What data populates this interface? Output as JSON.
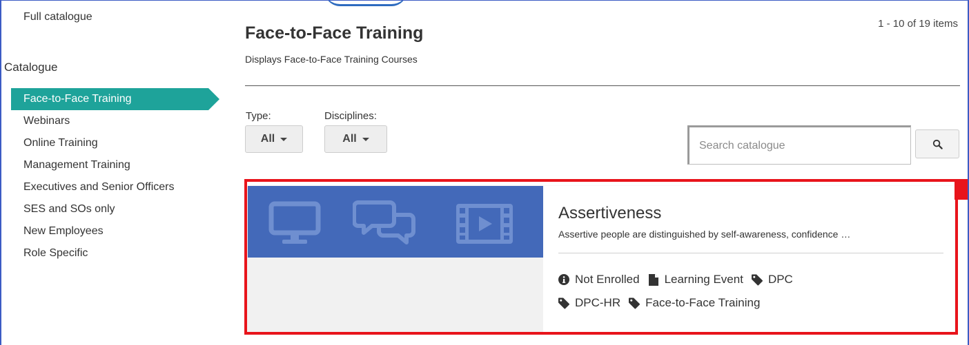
{
  "sidebar": {
    "full_catalogue": "Full catalogue",
    "heading": "Catalogue",
    "items": [
      {
        "label": "Face-to-Face Training",
        "active": true
      },
      {
        "label": "Webinars",
        "active": false
      },
      {
        "label": "Online Training",
        "active": false
      },
      {
        "label": "Management Training",
        "active": false
      },
      {
        "label": "Executives and Senior Officers",
        "active": false
      },
      {
        "label": "SES and SOs only",
        "active": false
      },
      {
        "label": "New Employees",
        "active": false
      },
      {
        "label": "Role Specific",
        "active": false
      }
    ]
  },
  "main": {
    "title": "Face-to-Face Training",
    "subtitle": "Displays Face-to-Face Training Courses",
    "pagination": "1 - 10 of 19 items",
    "filters": {
      "type": {
        "label": "Type:",
        "value": "All"
      },
      "disciplines": {
        "label": "Disciplines:",
        "value": "All"
      }
    },
    "search": {
      "placeholder": "Search catalogue",
      "value": "",
      "icon": "search-icon"
    }
  },
  "course": {
    "title": "Assertiveness",
    "description": "Assertive people are distinguished by self-awareness, confidence …",
    "banner_icons": [
      "monitor-icon",
      "chat-bubbles-icon",
      "film-play-icon"
    ],
    "meta": {
      "status": {
        "label": "Not Enrolled",
        "icon": "info-icon"
      },
      "type": {
        "label": "Learning Event",
        "icon": "document-icon"
      },
      "tags": [
        {
          "label": "DPC",
          "icon": "tag-icon"
        },
        {
          "label": "DPC-HR",
          "icon": "tag-icon"
        },
        {
          "label": "Face-to-Face Training",
          "icon": "tag-icon"
        }
      ]
    }
  },
  "colors": {
    "accent": "#1ea39a",
    "banner": "#4369b9",
    "highlight": "#e8141b",
    "frame": "#3b5bc4"
  }
}
